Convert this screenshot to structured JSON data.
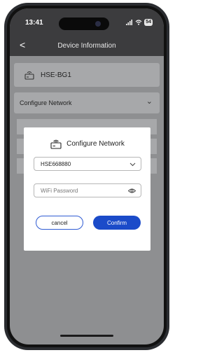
{
  "status_bar": {
    "time": "13:41",
    "battery": "54"
  },
  "nav": {
    "back_glyph": "<",
    "title": "Device Information"
  },
  "device": {
    "name": "HSE-BG1",
    "icon": "router-icon"
  },
  "section": {
    "label": "Configure Network",
    "icon": "chevron-down-icon"
  },
  "dialog": {
    "title": "Configure Network",
    "ssid_value": "HSE668880",
    "password_placeholder": "WiFi Password",
    "cancel_label": "cancel",
    "confirm_label": "Confirm"
  },
  "colors": {
    "accent": "#1b4bc9",
    "overlay": "#8e8f91",
    "bar": "#3c3c3e"
  }
}
